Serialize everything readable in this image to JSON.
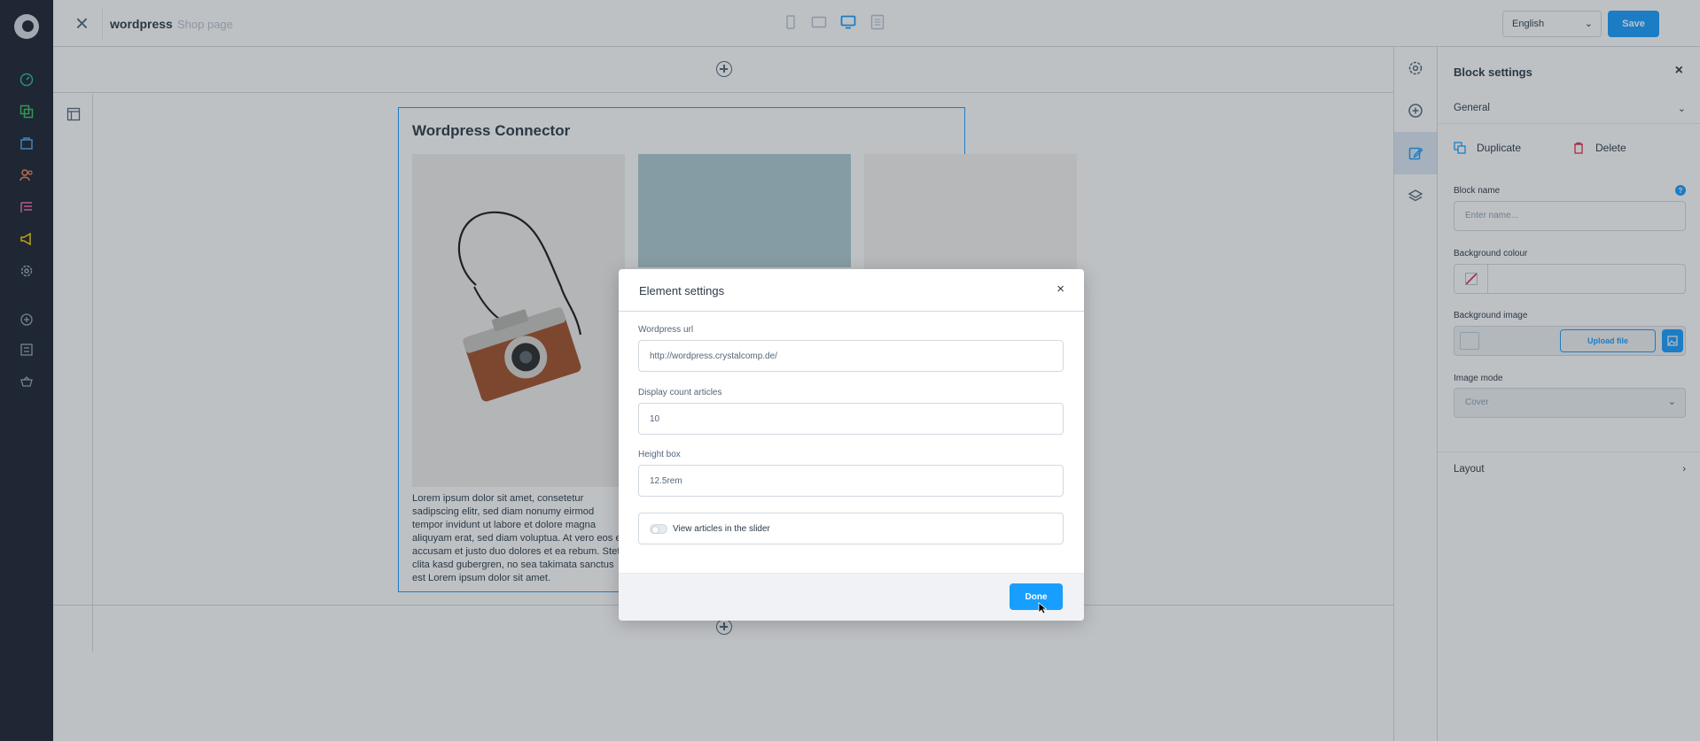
{
  "topbar": {
    "page_name": "wordpress",
    "page_type": "Shop page",
    "language": "English",
    "save_label": "Save"
  },
  "canvas": {
    "block_title": "Wordpress Connector",
    "article_excerpt": "Lorem ipsum dolor sit amet, consetetur sadipscing elitr, sed diam nonumy eirmod tempor invidunt ut labore et dolore magna aliquyam erat, sed diam voluptua. At vero eos et accusam et justo duo dolores et ea rebum. Stet clita kasd gubergren, no sea takimata sanctus est Lorem ipsum dolor sit amet."
  },
  "settings": {
    "title": "Block settings",
    "general_label": "General",
    "duplicate_label": "Duplicate",
    "delete_label": "Delete",
    "block_name_label": "Block name",
    "block_name_placeholder": "Enter name...",
    "background_colour_label": "Background colour",
    "background_image_label": "Background image",
    "upload_file_label": "Upload file",
    "image_mode_label": "Image mode",
    "image_mode_value": "Cover",
    "layout_label": "Layout"
  },
  "modal": {
    "title": "Element settings",
    "wordpress_url_label": "Wordpress url",
    "wordpress_url_value": "http://wordpress.crystalcomp.de/",
    "display_count_label": "Display count articles",
    "display_count_value": "10",
    "height_box_label": "Height box",
    "height_box_value": "12.5rem",
    "slider_toggle_label": "View articles in the slider",
    "slider_toggle_on": false,
    "done_label": "Done"
  },
  "colors": {
    "accent": "#189eff",
    "nav_bg": "#1b2330"
  }
}
